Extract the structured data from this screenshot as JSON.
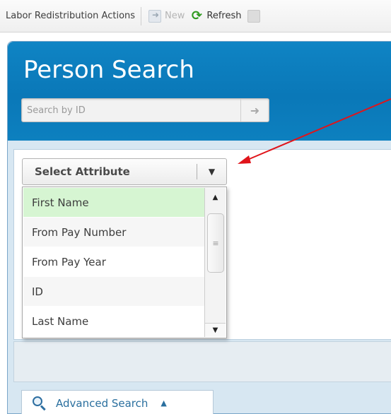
{
  "toolbar": {
    "title": "Labor Redistribution Actions",
    "new_label": "New",
    "refresh_label": "Refresh"
  },
  "search": {
    "title": "Person Search",
    "placeholder": "Search by ID",
    "go_icon": "arrow-right-icon"
  },
  "attribute_select": {
    "label": "Select Attribute",
    "options": [
      "First Name",
      "From Pay Number",
      "From Pay Year",
      "ID",
      "Last Name"
    ],
    "highlighted": "First Name"
  },
  "advanced_search": {
    "label": "Advanced Search"
  },
  "colors": {
    "header_blue": "#0a78b8",
    "highlight_green": "#d6f5d2",
    "annotation_red": "#e0141a"
  }
}
